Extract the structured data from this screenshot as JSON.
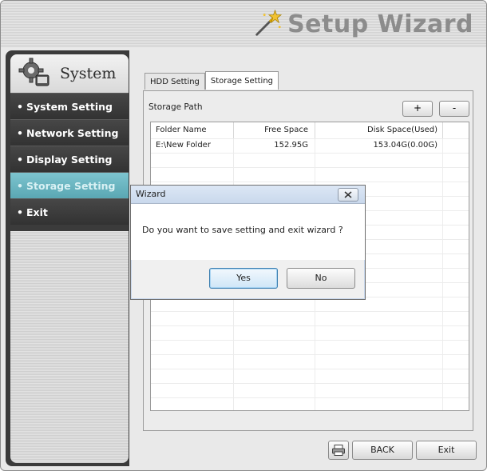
{
  "window": {
    "title": "Setup Wizard"
  },
  "sidebar": {
    "title": "System",
    "items": [
      {
        "label": "System Setting"
      },
      {
        "label": "Network Setting"
      },
      {
        "label": "Display Setting"
      },
      {
        "label": "Storage Setting",
        "active": true
      },
      {
        "label": "Exit"
      }
    ],
    "bullet": "•"
  },
  "tabs": [
    {
      "label": "HDD Setting"
    },
    {
      "label": "Storage Setting",
      "active": true
    }
  ],
  "storage": {
    "path_label": "Storage Path",
    "add_label": "+",
    "remove_label": "-",
    "columns": [
      "Folder Name",
      "Free Space",
      "Disk Space(Used)"
    ],
    "rows": [
      {
        "folder": "E:\\New Folder",
        "free": "152.95G",
        "disk": "153.04G(0.00G)"
      }
    ]
  },
  "footer": {
    "back_label": "BACK",
    "exit_label": "Exit"
  },
  "dialog": {
    "title": "Wizard",
    "message": "Do you want to save setting and exit wizard ?",
    "yes_label": "Yes",
    "no_label": "No"
  },
  "colors": {
    "accent": "#6bb8c3",
    "sidebar_bg": "#3b3b3b",
    "title_text": "#8c8c8c"
  }
}
